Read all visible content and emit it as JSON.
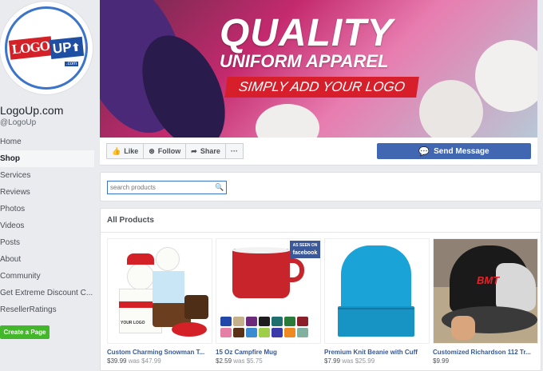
{
  "page": {
    "name": "LogoUp.com",
    "handle": "@LogoUp"
  },
  "logo": {
    "part1": "LOGO",
    "part2": "UP",
    "suffix": ".com"
  },
  "nav": [
    {
      "label": "Home"
    },
    {
      "label": "Shop",
      "active": true
    },
    {
      "label": "Services"
    },
    {
      "label": "Reviews"
    },
    {
      "label": "Photos"
    },
    {
      "label": "Videos"
    },
    {
      "label": "Posts"
    },
    {
      "label": "About"
    },
    {
      "label": "Community"
    },
    {
      "label": "Get Extreme Discount C..."
    },
    {
      "label": "ResellerRatings"
    }
  ],
  "create_page": "Create a Page",
  "cover": {
    "title": "QUALITY",
    "subtitle": "UNIFORM APPAREL",
    "tagline": "SIMPLY ADD YOUR LOGO"
  },
  "actions": {
    "like": "Like",
    "follow": "Follow",
    "share": "Share",
    "more": "···",
    "message": "Send Message"
  },
  "search": {
    "placeholder": "search products",
    "value": "search products"
  },
  "products_section": {
    "title": "All Products"
  },
  "products": [
    {
      "name": "Custom Charming Snowman T...",
      "price": "$39.99",
      "was_label": "was",
      "was": "$47.99"
    },
    {
      "name": "15 Oz Campfire Mug",
      "price": "$2.59",
      "was_label": "was",
      "was": "$5.75"
    },
    {
      "name": "Premium Knit Beanie with Cuff",
      "price": "$7.99",
      "was_label": "was",
      "was": "$25.99"
    },
    {
      "name": "Customized Richardson 112 Tr...",
      "price": "$9.99",
      "was_label": "",
      "was": ""
    }
  ],
  "product_art": {
    "mug_badge_line1": "AS SEEN ON",
    "mug_badge_line2": "facebook",
    "hat_logo": "BMT",
    "snowman_tag": "YOUR LOGO"
  },
  "colors": {
    "fb_blue": "#4267b2",
    "link": "#365899",
    "green": "#42b72a",
    "cover_red": "#d71e2b",
    "beanie": "#1aa3d6"
  }
}
